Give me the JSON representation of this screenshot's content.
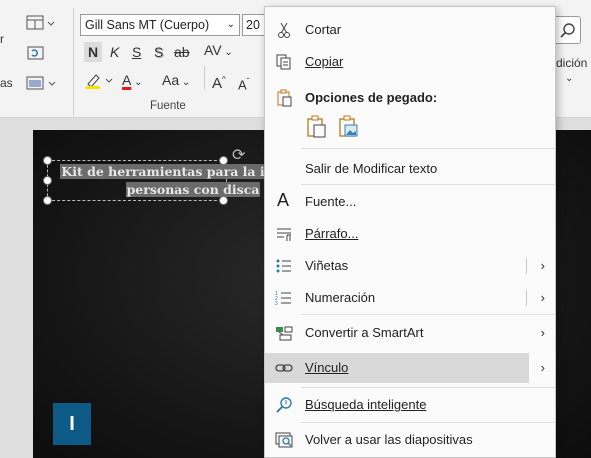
{
  "ribbon": {
    "font_name": "Gill Sans MT (Cuerpo)",
    "font_size": "20",
    "bold": "N",
    "italic": "K",
    "underline": "S",
    "shadow": "S",
    "strike": "ab",
    "spacing": "AV",
    "font_color_letter": "A",
    "change_case": "Aa",
    "grow": "A",
    "shrink": "A",
    "group_label": "Fuente",
    "left_partial_1": "r",
    "left_partial_2": "as",
    "right_partial": "dición"
  },
  "slide": {
    "title_line1": "Kit de herramientas para la i",
    "title_line2": "personas con disca",
    "section_letter": "I"
  },
  "menu": {
    "cut": "Cortar",
    "copy": "Copiar",
    "paste_options": "Opciones de pegado:",
    "exit_edit": "Salir de Modificar texto",
    "font": "Fuente...",
    "paragraph": "Párrafo...",
    "bullets": "Viñetas",
    "numbering": "Numeración",
    "smartart": "Convertir a SmartArt",
    "link": "Vínculo",
    "smart_lookup": "Búsqueda inteligente",
    "reuse_slides": "Volver a usar las diapositivas"
  },
  "colors": {
    "accent": "#0e5a87",
    "highlight_yellow": "#f5e000",
    "font_red": "#d92020",
    "menu_hover": "#d9d9d9"
  }
}
